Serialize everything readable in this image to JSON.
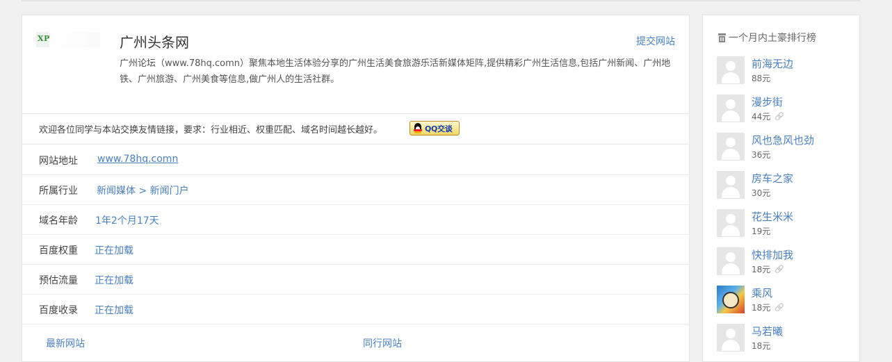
{
  "site": {
    "title": "广州头条网",
    "submit_label": "提交网站",
    "thumb_text": "XP",
    "description": "广州论坛（www.78hq.comn）聚焦本地生活体验分享的广州生活美食旅游乐活新媒体矩阵,提供精彩广州生活信息,包括广州新闻、广州地铁、广州旅游、广州美食等信息,做广州人的生活社群。"
  },
  "exchange": {
    "text": "欢迎各位同学与本站交换友情链接，要求：行业相近、权重匹配、域名时间越长越好。",
    "qq_label": "QQ交谈"
  },
  "info": {
    "url": {
      "label": "网站地址",
      "value": "www.78hq.comn"
    },
    "industry": {
      "label": "所属行业",
      "category": "新闻媒体",
      "separator": ">",
      "subcategory": "新闻门户"
    },
    "domain_age": {
      "label": "域名年龄",
      "value": "1年2个月17天"
    },
    "baidu_weight": {
      "label": "百度权重",
      "value": "正在加载"
    },
    "traffic": {
      "label": "预估流量",
      "value": "正在加载"
    },
    "baidu_index": {
      "label": "百度收录",
      "value": "正在加载"
    }
  },
  "tabs": {
    "latest": "最新网站",
    "same_industry": "同行网站"
  },
  "sidebar": {
    "title": "一个月内土豪排行榜",
    "items": [
      {
        "name": "前海无边",
        "amount": "88元",
        "has_link": false,
        "photo": false
      },
      {
        "name": "漫步街",
        "amount": "44元",
        "has_link": true,
        "photo": false
      },
      {
        "name": "风也急风也劲",
        "amount": "36元",
        "has_link": false,
        "photo": false
      },
      {
        "name": "房车之家",
        "amount": "30元",
        "has_link": false,
        "photo": false
      },
      {
        "name": "花生米米",
        "amount": "19元",
        "has_link": false,
        "photo": false
      },
      {
        "name": "快排加我",
        "amount": "18元",
        "has_link": true,
        "photo": false
      },
      {
        "name": "乘风",
        "amount": "18元",
        "has_link": true,
        "photo": true
      },
      {
        "name": "马若曦",
        "amount": "18元",
        "has_link": false,
        "photo": false
      }
    ]
  },
  "icons": {
    "link": "link-icon",
    "rank_title": "trash-icon",
    "avatar": "user-avatar-icon"
  },
  "colors": {
    "link": "#4a7fc0",
    "background": "#f0f0f0"
  }
}
